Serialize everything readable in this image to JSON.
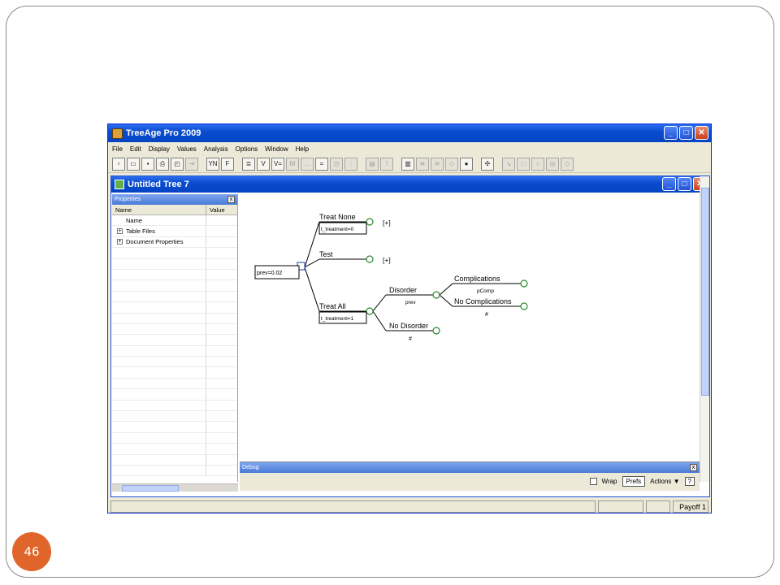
{
  "slide": {
    "page_number": "46",
    "accent_color": "#e0652a"
  },
  "app": {
    "title": "TreeAge Pro 2009",
    "menu": [
      "File",
      "Edit",
      "Display",
      "Values",
      "Analysis",
      "Options",
      "Window",
      "Help"
    ]
  },
  "doc": {
    "title": "Untitled Tree 7"
  },
  "properties": {
    "title": "Properties",
    "col_name": "Name",
    "col_value": "Value",
    "rows": [
      {
        "label": "Name",
        "expandable": false
      },
      {
        "label": "Table Files",
        "expandable": true
      },
      {
        "label": "Document Properties",
        "expandable": true
      }
    ]
  },
  "tree": {
    "root_label": "prev=0.02",
    "treat_none": {
      "name": "Treat None",
      "formula": "t_treatment=0",
      "collapsed": "[+]"
    },
    "test": {
      "name": "Test",
      "collapsed": "[+]"
    },
    "treat_all": {
      "name": "Treat All",
      "formula": "t_treatment=1"
    },
    "disorder": {
      "name": "Disorder",
      "prob": "prev"
    },
    "no_disorder": {
      "name": "No Disorder",
      "prob": "#"
    },
    "complications": {
      "name": "Complications",
      "prob": "pComp"
    },
    "no_complications": {
      "name": "No Complications",
      "prob": "#"
    }
  },
  "debug": {
    "title": "Debug",
    "wrap": "Wrap",
    "prefs": "Prefs",
    "actions": "Actions ▼",
    "help": "?"
  },
  "status": {
    "payoff": "Payoff 1"
  }
}
